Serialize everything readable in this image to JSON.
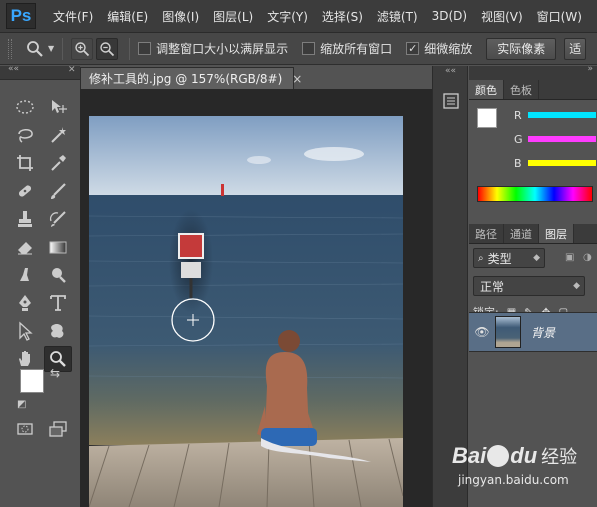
{
  "app": {
    "logo_text": "Ps"
  },
  "menu": [
    "文件(F)",
    "编辑(E)",
    "图像(I)",
    "图层(L)",
    "文字(Y)",
    "选择(S)",
    "滤镜(T)",
    "3D(D)",
    "视图(V)",
    "窗口(W)"
  ],
  "options": {
    "fit_window_label": "调整窗口大小以满屏显示",
    "fit_window_checked": false,
    "zoom_all_label": "缩放所有窗口",
    "zoom_all_checked": false,
    "scrubby_label": "细微缩放",
    "scrubby_checked": true,
    "actual_pixels_label": "实际像素",
    "fit_screen_label": "适"
  },
  "document": {
    "tab_title": "修补工具的.jpg @ 157%(RGB/8#)",
    "close_symbol": "×"
  },
  "color_panel": {
    "tabs": [
      "颜色",
      "色板"
    ],
    "channels": [
      {
        "label": "R",
        "color": "#00e5ff"
      },
      {
        "label": "G",
        "color": "#ff3cff"
      },
      {
        "label": "B",
        "color": "#ffff00"
      }
    ]
  },
  "layers_panel": {
    "tabs": [
      "路径",
      "通道",
      "图层"
    ],
    "filter_label": "类型",
    "blend_mode": "正常",
    "lock_label": "锁定:",
    "layers": [
      {
        "name": "背景"
      }
    ]
  },
  "watermark": {
    "brand_a": "Bai",
    "brand_b": "du",
    "brand_c": "经验",
    "url": "jingyan.baidu.com"
  },
  "colors": {
    "foreground": "#ffffff",
    "background": "#000000",
    "accent_blue": "#39a7ff"
  }
}
